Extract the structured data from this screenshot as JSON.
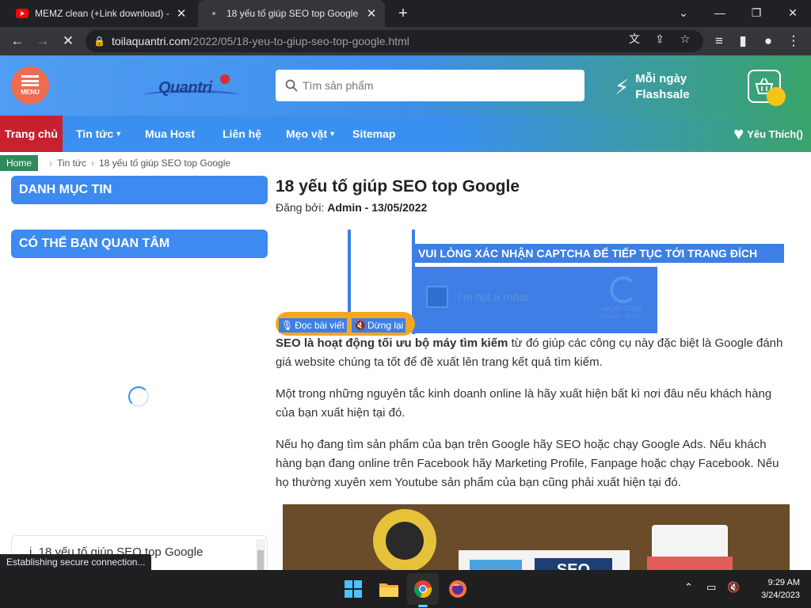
{
  "browser": {
    "tabs": [
      {
        "title": "MEMZ clean (+Link download) - ",
        "icon": "youtube-icon",
        "active": false
      },
      {
        "title": "18 yếu tố giúp SEO top Google",
        "icon": "loading-icon",
        "active": true
      }
    ],
    "url_host": "toilaquantri.com",
    "url_path": "/2022/05/18-yeu-to-giup-seo-top-google.html",
    "status_text": "Establishing secure connection..."
  },
  "site": {
    "menu_label": "MENU",
    "logo_text": "Quantri",
    "search_placeholder": "Tìm sản phẩm",
    "flashsale_line1": "Mỗi ngày",
    "flashsale_line2": "Flashsale",
    "nav": [
      {
        "label": "Trang chủ"
      },
      {
        "label": "Tin tức",
        "dropdown": true
      },
      {
        "label": "Mua Host"
      },
      {
        "label": "Liên hệ"
      },
      {
        "label": "Mẹo vặt",
        "dropdown": true
      },
      {
        "label": "Sitemap"
      }
    ],
    "favorites_label": "Yêu Thích()"
  },
  "breadcrumb": {
    "home": "Home",
    "category": "Tin tức",
    "current": "18 yếu tố giúp SEO top Google"
  },
  "sidebar": {
    "box1": "DANH MỤC TIN",
    "box2": "CÓ THỂ BẠN QUAN TÂM",
    "toc_item": "18 yếu tố giúp SEO top Google"
  },
  "article": {
    "title": "18 yếu tố giúp SEO top Google",
    "meta_prefix": "Đăng bởi:",
    "meta_author_date": "Admin - 13/05/2022",
    "tts_read": "Đọc bài viết",
    "tts_stop": "Dừng lại",
    "captcha_message": "VUI LÒNG XÁC NHẬN CAPTCHA ĐỂ TIẾP TỤC TỚI TRANG ĐÍCH",
    "captcha_label": "I'm not a robot",
    "captcha_brand": "reCAPTCHA",
    "captcha_terms": "Privacy - Terms",
    "p1_bold": "SEO là hoạt động tối ưu bộ máy tìm kiếm",
    "p1_rest": " từ đó giúp các công cụ này đặc biệt là Google đánh giá website chúng ta tốt để đề xuất lên trang kết quả tìm kiếm.",
    "p2": "Một trong những nguyên tắc kinh doanh online là hãy xuất hiện bất kì nơi đâu nếu khách hàng của bạn xuất hiện tại đó.",
    "p3": "Nếu họ đang tìm sản phẩm của bạn trên Google hãy SEO hoặc chạy Google Ads. Nếu khách hàng bạn đang online trên Facebook hãy Marketing Profile, Fanpage hoặc chạy Facebook. Nếu họ thường xuyên xem Youtube sản phẩm của bạn cũng phải xuất hiện tại đó.",
    "image_text": "SEO"
  },
  "taskbar": {
    "time": "9:29 AM",
    "date": "3/24/2023"
  }
}
